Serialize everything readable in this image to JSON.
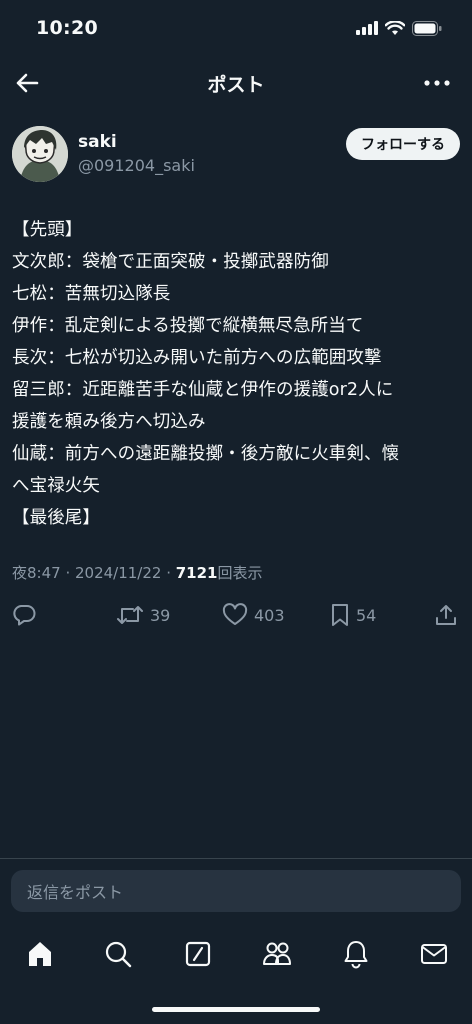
{
  "status_bar": {
    "time": "10:20"
  },
  "nav": {
    "title": "ポスト"
  },
  "author": {
    "display_name": "saki",
    "handle": "@091204_saki",
    "follow_label": "フォローする"
  },
  "post": {
    "text": "【先頭】\n文次郎：袋槍で正面突破・投擲武器防御\n七松：苦無切込隊長\n伊作：乱定剣による投擲で縦横無尽急所当て\n長次：七松が切込み開いた前方への広範囲攻撃\n留三郎：近距離苦手な仙蔵と伊作の援護or2人に\n援護を頼み後方へ切込み\n仙蔵：前方への遠距離投擲・後方敵に火車剣、懐\nへ宝禄火矢\n【最後尾】",
    "timestamp": "夜8:47 · 2024/11/22 · ",
    "views_count": "7121",
    "views_label": "回表示"
  },
  "actions": {
    "retweets": "39",
    "likes": "403",
    "bookmarks": "54"
  },
  "reply": {
    "placeholder": "返信をポスト"
  },
  "icons": {
    "back": "back-arrow-icon",
    "more": "more-icon",
    "reply": "reply-icon",
    "retweet": "retweet-icon",
    "like": "heart-icon",
    "bookmark": "bookmark-icon",
    "share": "share-icon",
    "tabs": [
      "home-icon",
      "search-icon",
      "grok-icon",
      "communities-icon",
      "notifications-icon",
      "messages-icon"
    ]
  },
  "colors": {
    "background": "#15202b",
    "text": "#f7f9f9",
    "secondary_text": "#8b98a5",
    "reply_field": "#273340",
    "divider": "#38444d"
  }
}
